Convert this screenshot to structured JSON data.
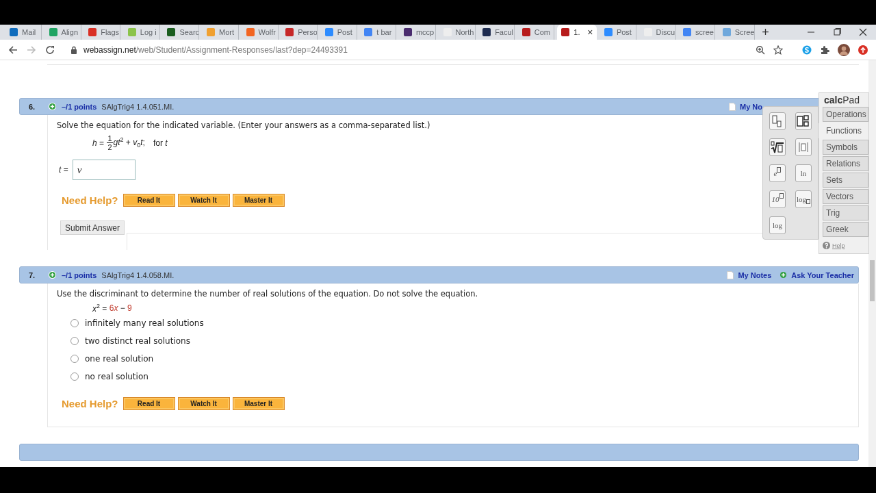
{
  "browser": {
    "tabs": [
      {
        "label": "Mail",
        "color": "#0f6cbd",
        "selected": false
      },
      {
        "label": "Align",
        "color": "#1fa463",
        "selected": false
      },
      {
        "label": "Flags",
        "color": "#d93025",
        "selected": false
      },
      {
        "label": "Log i",
        "color": "#8bc34a",
        "selected": false
      },
      {
        "label": "Searc",
        "color": "#1b5e20",
        "selected": false
      },
      {
        "label": "Mort",
        "color": "#f0a030",
        "selected": false
      },
      {
        "label": "Wolfr",
        "color": "#f26522",
        "selected": false
      },
      {
        "label": "Perso",
        "color": "#c62828",
        "selected": false
      },
      {
        "label": "Post",
        "color": "#2d8cff",
        "selected": false
      },
      {
        "label": "t bar",
        "color": "#4285f4",
        "selected": false
      },
      {
        "label": "mccp",
        "color": "#4a2c6e",
        "selected": false
      },
      {
        "label": "North",
        "color": "#eeeeee",
        "selected": false
      },
      {
        "label": "Facul",
        "color": "#1d2b4f",
        "selected": false
      },
      {
        "label": "Com",
        "color": "#b71c1c",
        "selected": false
      },
      {
        "label": "1.",
        "color": "#b71c1c",
        "selected": true
      },
      {
        "label": "Post",
        "color": "#2d8cff",
        "selected": false
      },
      {
        "label": "Discu",
        "color": "#eeeeee",
        "selected": false
      },
      {
        "label": "scree",
        "color": "#4285f4",
        "selected": false
      },
      {
        "label": "Scree",
        "color": "#6fa8dc",
        "selected": false
      }
    ],
    "close_tab": "×",
    "new_tab": "+",
    "url": {
      "host": "webassign.net",
      "path": "/web/Student/Assignment-Responses/last?dep=24493391"
    }
  },
  "questions": [
    {
      "number": "6.",
      "points": "–/1 points",
      "code": "SAlgTrig4 1.4.051.MI.",
      "notes": "My No",
      "prompt": "Solve the equation for the indicated variable. (Enter your answers as a comma-separated list.)",
      "equation": [
        {
          "kind": "text",
          "text": "*h* = "
        },
        {
          "kind": "fraction",
          "numerator": "1",
          "denominator": "2"
        },
        {
          "kind": "text",
          "text": "*gt*$^{2}$ + *v*$_{0}$*t*;"
        },
        {
          "kind": "note",
          "text": "for *t*"
        }
      ],
      "answer": {
        "label": "*t* =",
        "value": "v"
      },
      "help": {
        "label": "Need Help?",
        "buttons": [
          "Read It",
          "Watch It",
          "Master It"
        ]
      },
      "submit": "Submit Answer"
    },
    {
      "number": "7.",
      "points": "–/1 points",
      "code": "SAlgTrig4 1.4.058.MI.",
      "notes": "My Notes",
      "ask": "Ask Your Teacher",
      "prompt": "Use the discriminant to determine the number of real solutions of the equation. Do not solve the equation.",
      "equation": [
        {
          "kind": "text",
          "text": "*x*$^{2}$ = "
        },
        {
          "kind": "text",
          "text": "6",
          "color": "#c0392b"
        },
        {
          "kind": "text",
          "text": "*x*",
          "color": "#c0392b"
        },
        {
          "kind": "text",
          "text": " − "
        },
        {
          "kind": "text",
          "text": "9",
          "color": "#c0392b"
        }
      ],
      "options": [
        {
          "label": "infinitely many real solutions",
          "selected": false
        },
        {
          "label": "two distinct real solutions",
          "selected": false
        },
        {
          "label": "one real solution",
          "selected": false
        },
        {
          "label": "no real solution",
          "selected": false
        }
      ],
      "help": {
        "label": "Need Help?",
        "buttons": [
          "Read It",
          "Watch It",
          "Master It"
        ]
      }
    }
  ],
  "calcpad": {
    "title": "**calc**Pad",
    "tabs": [
      {
        "label": "Operations",
        "selected": false
      },
      {
        "label": "Functions",
        "selected": true
      },
      {
        "label": "Symbols",
        "selected": false
      },
      {
        "label": "Relations",
        "selected": false
      },
      {
        "label": "Sets",
        "selected": false
      },
      {
        "label": "Vectors",
        "selected": false
      },
      {
        "label": "Trig",
        "selected": false
      },
      {
        "label": "Greek",
        "selected": false
      }
    ],
    "keys": [
      {
        "kind": "subscript"
      },
      {
        "kind": "subsup"
      },
      {
        "kind": "root"
      },
      {
        "kind": "abs"
      },
      {
        "kind": "power",
        "label": "e"
      },
      {
        "kind": "word",
        "label": "ln"
      },
      {
        "kind": "power",
        "label": "10"
      },
      {
        "kind": "base",
        "label": "log"
      },
      {
        "kind": "word",
        "label": "log"
      }
    ],
    "help": "Help"
  }
}
